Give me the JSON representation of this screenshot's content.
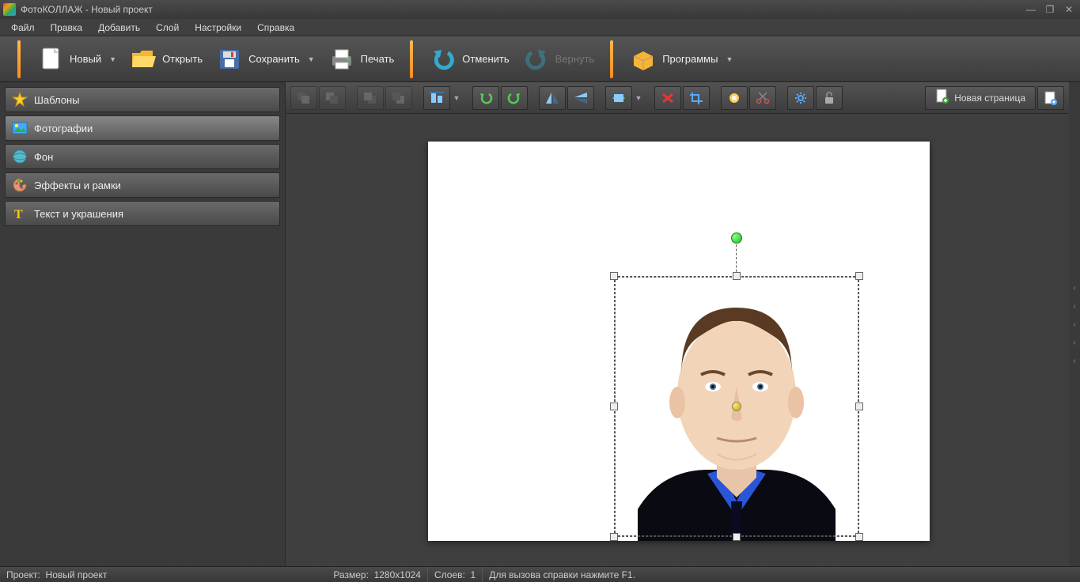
{
  "window": {
    "title": "ФотоКОЛЛАЖ - Новый проект"
  },
  "menu": {
    "file": "Файл",
    "edit": "Правка",
    "add": "Добавить",
    "layer": "Слой",
    "settings": "Настройки",
    "help": "Справка"
  },
  "toolbar": {
    "new": "Новый",
    "open": "Открыть",
    "save": "Сохранить",
    "print": "Печать",
    "undo": "Отменить",
    "redo": "Вернуть",
    "programs": "Программы"
  },
  "sidebar": {
    "templates": "Шаблоны",
    "photos": "Фотографии",
    "background": "Фон",
    "effects": "Эффекты и рамки",
    "text": "Текст и украшения"
  },
  "canvas_toolbar": {
    "new_page": "Новая страница"
  },
  "status": {
    "project_label": "Проект:",
    "project_value": "Новый проект",
    "size_label": "Размер:",
    "size_value": "1280x1024",
    "layers_label": "Слоев:",
    "layers_value": "1",
    "help_hint": "Для вызова справки нажмите F1."
  }
}
